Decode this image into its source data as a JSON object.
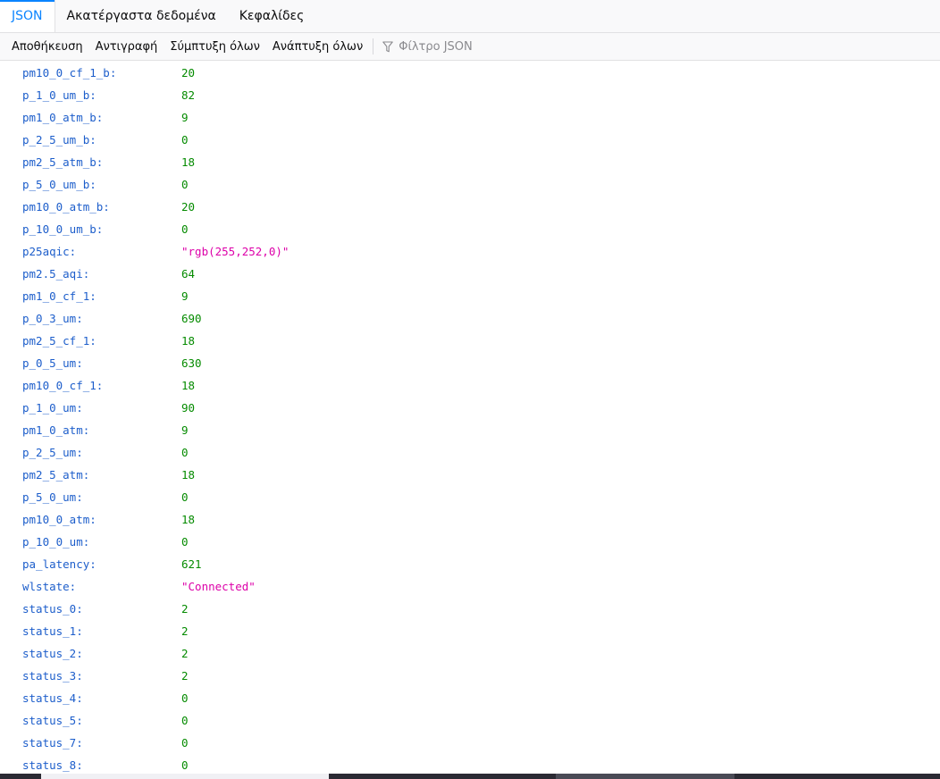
{
  "tabs": [
    {
      "label": "JSON",
      "active": true
    },
    {
      "label": "Ακατέργαστα δεδομένα",
      "active": false
    },
    {
      "label": "Κεφαλίδες",
      "active": false
    }
  ],
  "toolbar": {
    "save": "Αποθήκευση",
    "copy": "Αντιγραφή",
    "collapse_all": "Σύμπτυξη όλων",
    "expand_all": "Ανάπτυξη όλων",
    "filter_placeholder": "Φίλτρο JSON",
    "filter_icon": "funnel-icon"
  },
  "rows": [
    {
      "key": "pm10_0_cf_1_b:",
      "value": "20",
      "type": "num"
    },
    {
      "key": "p_1_0_um_b:",
      "value": "82",
      "type": "num"
    },
    {
      "key": "pm1_0_atm_b:",
      "value": "9",
      "type": "num"
    },
    {
      "key": "p_2_5_um_b:",
      "value": "0",
      "type": "num"
    },
    {
      "key": "pm2_5_atm_b:",
      "value": "18",
      "type": "num"
    },
    {
      "key": "p_5_0_um_b:",
      "value": "0",
      "type": "num"
    },
    {
      "key": "pm10_0_atm_b:",
      "value": "20",
      "type": "num"
    },
    {
      "key": "p_10_0_um_b:",
      "value": "0",
      "type": "num"
    },
    {
      "key": "p25aqic:",
      "value": "\"rgb(255,252,0)\"",
      "type": "str"
    },
    {
      "key": "pm2.5_aqi:",
      "value": "64",
      "type": "num"
    },
    {
      "key": "pm1_0_cf_1:",
      "value": "9",
      "type": "num"
    },
    {
      "key": "p_0_3_um:",
      "value": "690",
      "type": "num"
    },
    {
      "key": "pm2_5_cf_1:",
      "value": "18",
      "type": "num"
    },
    {
      "key": "p_0_5_um:",
      "value": "630",
      "type": "num"
    },
    {
      "key": "pm10_0_cf_1:",
      "value": "18",
      "type": "num"
    },
    {
      "key": "p_1_0_um:",
      "value": "90",
      "type": "num"
    },
    {
      "key": "pm1_0_atm:",
      "value": "9",
      "type": "num"
    },
    {
      "key": "p_2_5_um:",
      "value": "0",
      "type": "num"
    },
    {
      "key": "pm2_5_atm:",
      "value": "18",
      "type": "num"
    },
    {
      "key": "p_5_0_um:",
      "value": "0",
      "type": "num"
    },
    {
      "key": "pm10_0_atm:",
      "value": "18",
      "type": "num"
    },
    {
      "key": "p_10_0_um:",
      "value": "0",
      "type": "num"
    },
    {
      "key": "pa_latency:",
      "value": "621",
      "type": "num"
    },
    {
      "key": "wlstate:",
      "value": "\"Connected\"",
      "type": "str"
    },
    {
      "key": "status_0:",
      "value": "2",
      "type": "num"
    },
    {
      "key": "status_1:",
      "value": "2",
      "type": "num"
    },
    {
      "key": "status_2:",
      "value": "2",
      "type": "num"
    },
    {
      "key": "status_3:",
      "value": "2",
      "type": "num"
    },
    {
      "key": "status_4:",
      "value": "0",
      "type": "num"
    },
    {
      "key": "status_5:",
      "value": "0",
      "type": "num"
    },
    {
      "key": "status_7:",
      "value": "0",
      "type": "num"
    },
    {
      "key": "status_8:",
      "value": "0",
      "type": "num"
    }
  ],
  "colors": {
    "accent": "#0a84ff",
    "key": "#1d5ecb",
    "number": "#058b00",
    "string": "#dd00a9"
  }
}
